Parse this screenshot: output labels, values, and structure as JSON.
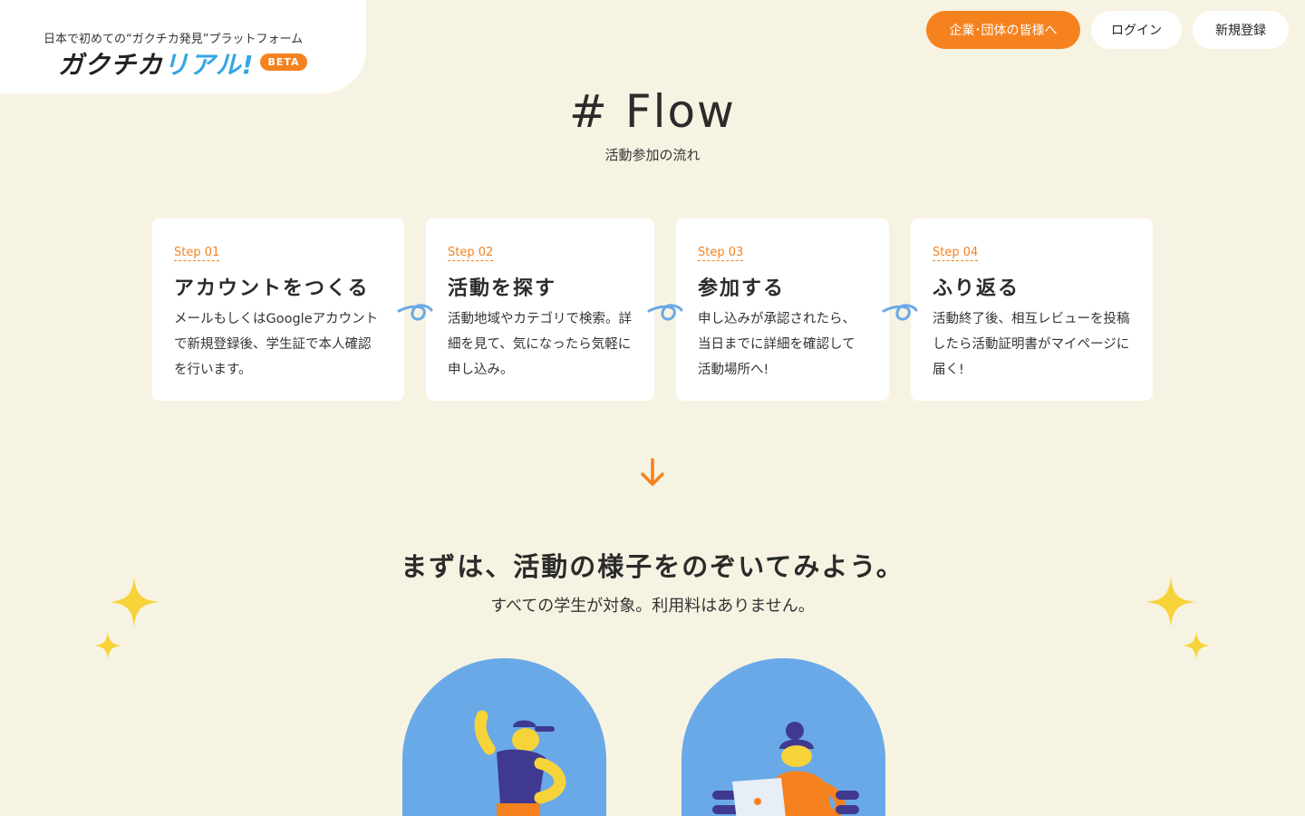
{
  "header": {
    "tagline": "日本で初めての“ガクチカ発見”プラットフォーム",
    "logo_main": "ガクチカ",
    "logo_accent": "リアル!",
    "beta": "BETA",
    "org_button": "企業･団体の皆様へ",
    "login_button": "ログイン",
    "signup_button": "新規登録"
  },
  "flow": {
    "title": "# Flow",
    "subtitle": "活動参加の流れ",
    "steps": [
      {
        "label": "Step 01",
        "title": "アカウントをつくる",
        "desc": "メールもしくはGoogleアカウントで新規登録後、学生証で本人確認を行います。"
      },
      {
        "label": "Step 02",
        "title": "活動を探す",
        "desc": "活動地域やカテゴリで検索。詳細を見て、気になったら気軽に申し込み。"
      },
      {
        "label": "Step 03",
        "title": "参加する",
        "desc": "申し込みが承認されたら、当日までに詳細を確認して活動場所へ!"
      },
      {
        "label": "Step 04",
        "title": "ふり返る",
        "desc": "活動終了後、相互レビューを投稿したら活動証明書がマイページに届く!"
      }
    ]
  },
  "intro": {
    "headline": "まずは、活動の様子をのぞいてみよう。",
    "subline": "すべての学生が対象。利用料はありません。"
  },
  "colors": {
    "background": "#f7f3e2",
    "accent_orange": "#f5821f",
    "accent_blue": "#6aa9e8",
    "sparkle_yellow": "#f7d33a"
  }
}
